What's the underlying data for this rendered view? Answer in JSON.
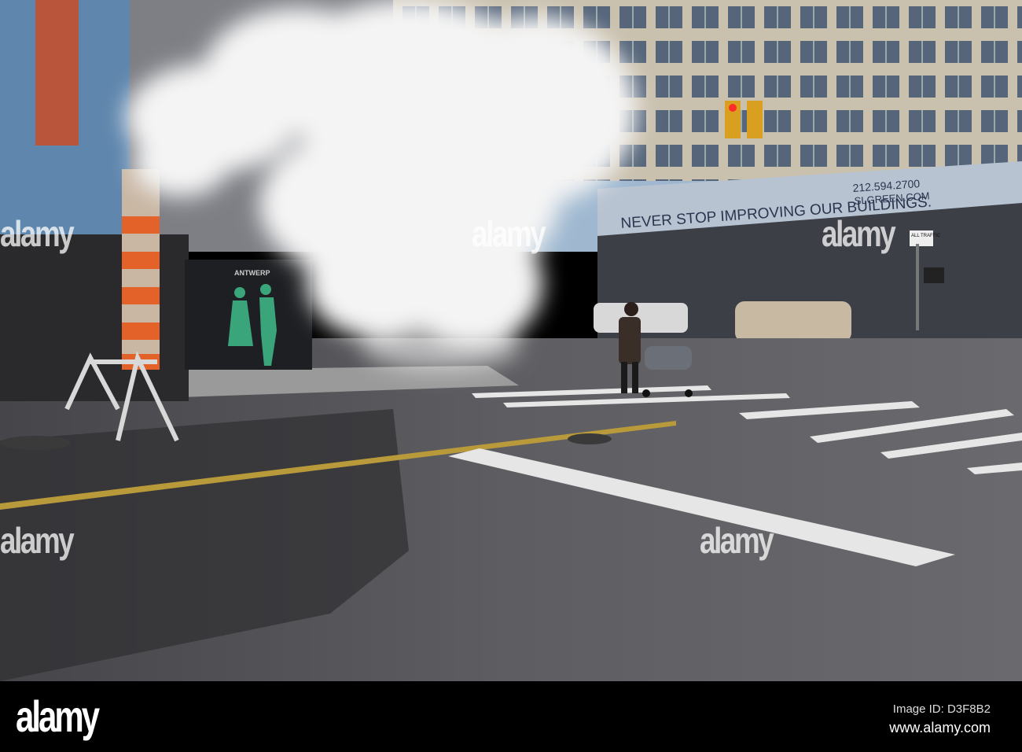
{
  "scene": {
    "description_labels": {
      "construction_panel": "ANTWERP",
      "banner_slogan": "NEVER STOP IMPROVING OUR BUILDINGS.",
      "banner_phone": "212.594.2700",
      "banner_url": "SLGREEN.COM",
      "traffic_sign": "ALL TRAFFIC"
    }
  },
  "watermark": {
    "text": "alamy"
  },
  "footer": {
    "logo": "alamy",
    "image_id": "Image ID: D3F8B2",
    "url": "www.alamy.com"
  },
  "colors": {
    "sky": "#9fb8d0",
    "asphalt": "#58585c",
    "steam": "#f4f4f4",
    "pole_orange": "#e2622a",
    "figure_green": "#3aa57a"
  }
}
